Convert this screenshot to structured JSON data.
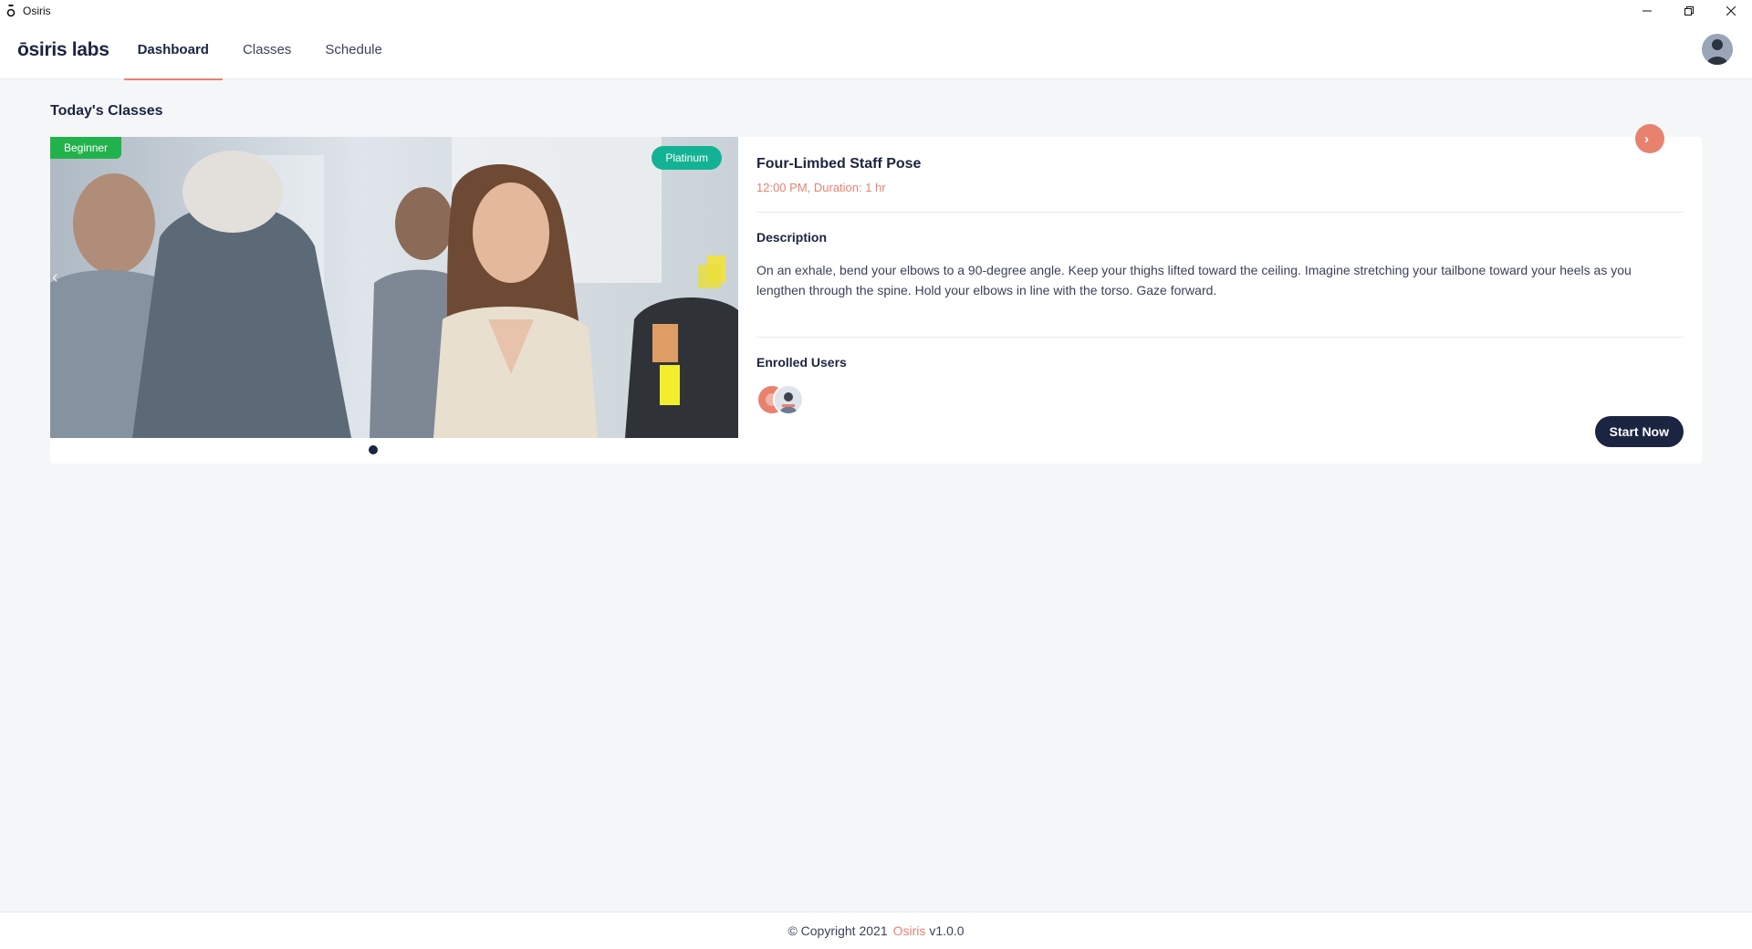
{
  "window": {
    "title": "Osiris",
    "icon": "osiris-app-icon",
    "controls": [
      "minimize-icon",
      "restore-icon",
      "close-icon"
    ]
  },
  "header": {
    "logo": "ōsiris labs",
    "tabs": [
      {
        "label": "Dashboard",
        "active": true
      },
      {
        "label": "Classes",
        "active": false
      },
      {
        "label": "Schedule",
        "active": false
      }
    ],
    "avatar_icon": "user-avatar"
  },
  "main": {
    "section_title": "Today's Classes",
    "class_card": {
      "level_badge": "Beginner",
      "tier_badge": "Platinum",
      "name": "Four-Limbed Staff Pose",
      "time": "12:00 PM, Duration: 1 hr",
      "description_label": "Description",
      "description": "On an exhale, bend your elbows to a 90-degree angle. Keep your thighs lifted toward the ceiling. Imagine stretching your tailbone toward your heels as you lengthen through the spine. Hold your elbows in line with the torso. Gaze forward.",
      "enrolled_label": "Enrolled Users",
      "enrolled_users": [
        "user-avatar",
        "user-avatar"
      ],
      "start_button": "Start Now",
      "carousel": {
        "prev_icon": "chevron-left-icon",
        "next_icon": "chevron-right-icon",
        "slides": 1,
        "active_slide": 1
      }
    }
  },
  "footer": {
    "copyright": "© Copyright 2021",
    "brand": "Osiris",
    "version": "v1.0.0"
  },
  "colors": {
    "accent": "#e8826f",
    "navy": "#1b2440",
    "beginner_green": "#22b24c",
    "platinum_teal": "#14b294",
    "background": "#f5f6f8"
  }
}
